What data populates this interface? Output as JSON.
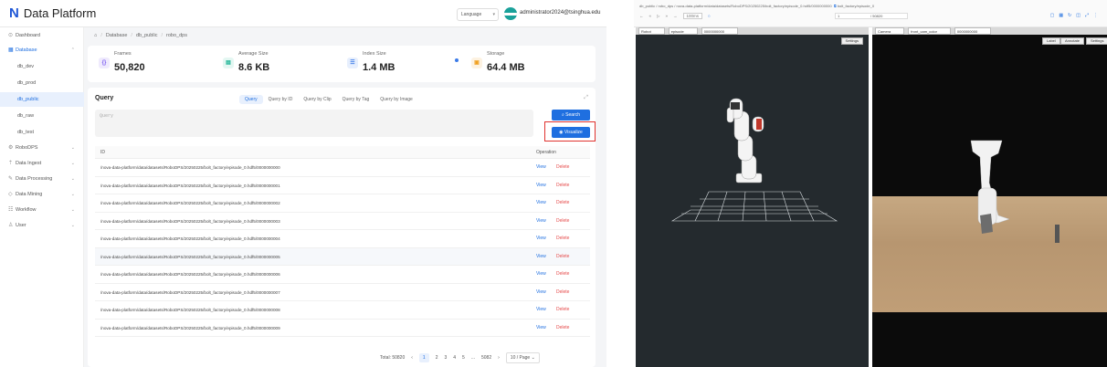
{
  "app": {
    "brand": "Data Platform",
    "language": "Language",
    "user": "administrator2024@tsinghua.edu"
  },
  "sidebar": {
    "items": [
      {
        "label": "Dashboard",
        "icon": "dashboard-icon"
      },
      {
        "label": "Database",
        "icon": "database-icon"
      },
      {
        "label": "db_dev"
      },
      {
        "label": "db_prod"
      },
      {
        "label": "db_public"
      },
      {
        "label": "db_raw"
      },
      {
        "label": "db_test"
      },
      {
        "label": "RoboDPS",
        "icon": "robot-icon"
      },
      {
        "label": "Data Ingest",
        "icon": "upload-icon"
      },
      {
        "label": "Data Processing",
        "icon": "wrench-icon"
      },
      {
        "label": "Data Mining",
        "icon": "mining-icon"
      },
      {
        "label": "Workflow",
        "icon": "workflow-icon"
      },
      {
        "label": "User",
        "icon": "user-icon"
      }
    ]
  },
  "breadcrumb": [
    "Database",
    "db_public",
    "robo_dps"
  ],
  "stats": [
    {
      "label": "Frames",
      "value": "50,820",
      "color": "#7b5cf0",
      "icon": "frames-icon"
    },
    {
      "label": "Average Size",
      "value": "8.6 KB",
      "color": "#1ab394",
      "icon": "file-icon"
    },
    {
      "label": "Index Size",
      "value": "1.4 MB",
      "color": "#3b7be8",
      "icon": "index-icon"
    },
    {
      "label": "Storage",
      "value": "64.4 MB",
      "color": "#f0a020",
      "icon": "storage-icon"
    }
  ],
  "query": {
    "title": "Query",
    "tabs": [
      "Query",
      "Query by ID",
      "Query by Clip",
      "Query by Tag",
      "Query by Image"
    ],
    "placeholder": "Query",
    "search_label": "Search",
    "visualize_label": "Visualize"
  },
  "table": {
    "col_id": "ID",
    "col_op": "Operation",
    "view_label": "View",
    "delete_label": "Delete",
    "rows": [
      "/nova-data-platform/data/datasets/RoboDPS/20250225/bolt_factory/episode_0.hdf5/0000000000",
      "/nova-data-platform/data/datasets/RoboDPS/20250225/bolt_factory/episode_0.hdf5/0000000001",
      "/nova-data-platform/data/datasets/RoboDPS/20250225/bolt_factory/episode_0.hdf5/0000000002",
      "/nova-data-platform/data/datasets/RoboDPS/20250225/bolt_factory/episode_0.hdf5/0000000003",
      "/nova-data-platform/data/datasets/RoboDPS/20250225/bolt_factory/episode_0.hdf5/0000000004",
      "/nova-data-platform/data/datasets/RoboDPS/20250225/bolt_factory/episode_0.hdf5/0000000005",
      "/nova-data-platform/data/datasets/RoboDPS/20250225/bolt_factory/episode_0.hdf5/0000000006",
      "/nova-data-platform/data/datasets/RoboDPS/20250225/bolt_factory/episode_0.hdf5/0000000007",
      "/nova-data-platform/data/datasets/RoboDPS/20250225/bolt_factory/episode_0.hdf5/0000000008",
      "/nova-data-platform/data/datasets/RoboDPS/20250225/bolt_factory/episode_0.hdf5/0000000009"
    ]
  },
  "pagination": {
    "total": "Total: 50820",
    "pages": [
      "1",
      "2",
      "3",
      "4",
      "5",
      "...",
      "5082"
    ],
    "page_size": "10 / Page"
  },
  "viewer": {
    "path": "db_public / robo_dps / nova-data-platform/data/datasets/RoboDPS/20250225/bolt_factory/episode_0.hdf5/0000000000",
    "path_tag": "bolt_factory/episode_0",
    "zoom": "100ms",
    "frame": "1",
    "frame_total": "/ 50820",
    "left_bar": [
      "Robot",
      "episode",
      "0000000000"
    ],
    "right_bar": [
      "Camera",
      "front_cam_color",
      "0000000000"
    ],
    "settings_label": "Settings",
    "right_buttons": [
      "Label",
      "Annotate",
      "Settings"
    ]
  }
}
